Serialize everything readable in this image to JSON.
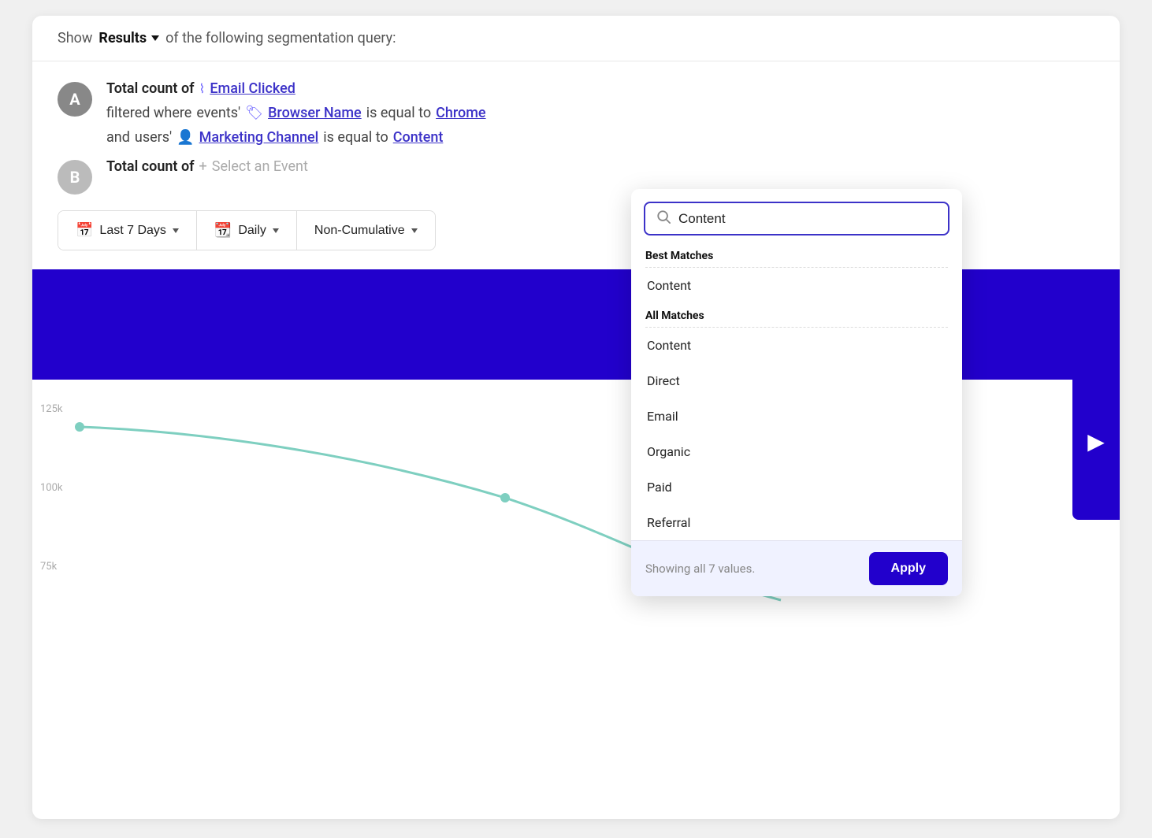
{
  "header": {
    "show_label": "Show",
    "results_label": "Results",
    "rest_label": "of the following segmentation query:"
  },
  "row_a": {
    "badge": "A",
    "total_count_label": "Total count of",
    "event_name": "Email Clicked",
    "filtered_where_label": "filtered where",
    "events_label": "events'",
    "property1_name": "Browser Name",
    "is_equal_to1": "is equal to",
    "value1": "Chrome",
    "and_label": "and",
    "users_label": "users'",
    "property2_name": "Marketing Channel",
    "is_equal_to2": "is equal to",
    "value2": "Content"
  },
  "row_b": {
    "badge": "B",
    "total_count_label": "Total count of",
    "add_event_label": "Select an Event"
  },
  "filter_bar": {
    "date_label": "Last 7 Days",
    "interval_label": "Daily",
    "mode_label": "Non-Cumulative"
  },
  "chart": {
    "y_labels": [
      "125k",
      "100k",
      "75k"
    ]
  },
  "dropdown": {
    "search_value": "Content",
    "best_matches_label": "Best Matches",
    "all_matches_label": "All Matches",
    "items": [
      {
        "label": "Content",
        "section": "best"
      },
      {
        "label": "Content",
        "section": "all"
      },
      {
        "label": "Direct",
        "section": "all"
      },
      {
        "label": "Email",
        "section": "all"
      },
      {
        "label": "Organic",
        "section": "all"
      },
      {
        "label": "Paid",
        "section": "all"
      },
      {
        "label": "Referral",
        "section": "all"
      }
    ],
    "footer_count": "Showing all 7 values.",
    "apply_label": "Apply"
  }
}
